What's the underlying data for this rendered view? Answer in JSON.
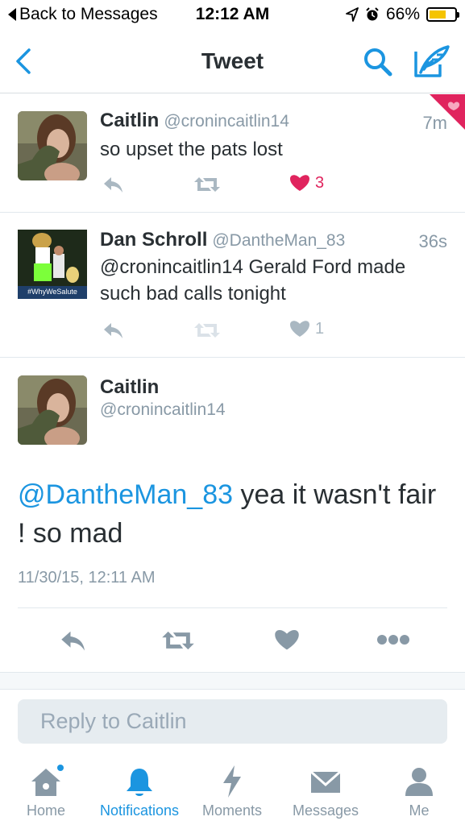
{
  "status_bar": {
    "back_label": "Back to Messages",
    "time": "12:12 AM",
    "battery": "66%",
    "battery_level": 0.66
  },
  "nav": {
    "title": "Tweet"
  },
  "tweets": [
    {
      "name": "Caitlin",
      "handle": "@cronincaitlin14",
      "time": "7m",
      "text": "so upset the pats lost",
      "likes": "3"
    },
    {
      "name": "Dan Schroll",
      "handle": "@DantheMan_83",
      "time": "36s",
      "text": "@cronincaitlin14 Gerald Ford made such bad calls tonight",
      "likes": "1",
      "avatar_caption": "#WhyWeSalute"
    }
  ],
  "detail": {
    "name": "Caitlin",
    "handle": "@cronincaitlin14",
    "mention": "@DantheMan_83",
    "text": " yea it wasn't fair ! so mad",
    "timestamp": "11/30/15, 12:11 AM"
  },
  "reply": {
    "placeholder": "Reply to Caitlin"
  },
  "tabs": [
    {
      "label": "Home"
    },
    {
      "label": "Notifications"
    },
    {
      "label": "Moments"
    },
    {
      "label": "Messages"
    },
    {
      "label": "Me"
    }
  ],
  "colors": {
    "accent": "#1b95e0",
    "like_red": "#e0245e",
    "icon_gray": "#8899a6",
    "action_gray": "#aab8c2"
  }
}
